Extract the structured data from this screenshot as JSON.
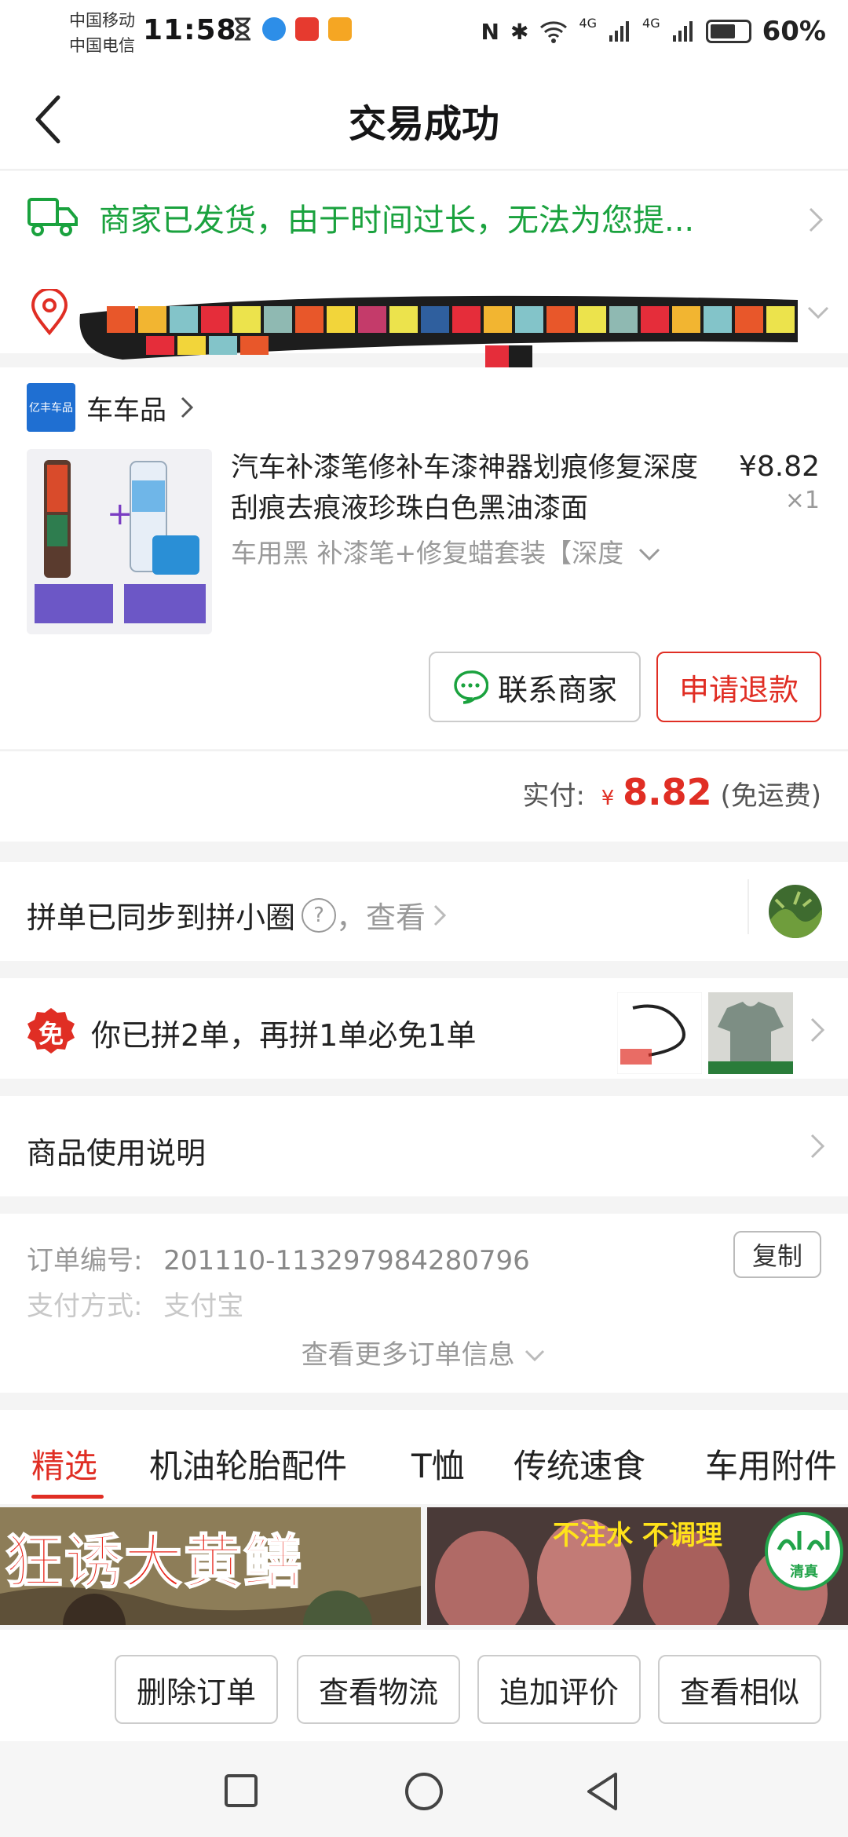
{
  "status_bar": {
    "carrier_1": "中国移动",
    "carrier_2": "中国电信",
    "time": "11:58",
    "network_1": "4G",
    "network_2": "4G",
    "battery": "60%"
  },
  "header": {
    "title": "交易成功"
  },
  "shipping": {
    "text": "商家已发货，由于时间过长，无法为您提...",
    "color": "#1aa23e"
  },
  "shop": {
    "logo_text": "亿丰车品",
    "name": "车车品"
  },
  "product": {
    "title": "汽车补漆笔修补车漆神器划痕修复深度刮痕去痕液珍珠白色黑油漆面",
    "spec": "车用黑 补漆笔+修复蜡套装【深度",
    "price": "¥8.82",
    "quantity": "×1"
  },
  "actions": {
    "contact": "联系商家",
    "refund": "申请退款"
  },
  "payment": {
    "label": "实付:",
    "currency": "¥",
    "amount": "8.82",
    "shipping_note": "(免运费)",
    "accent_color": "#e02e24"
  },
  "group_sync": {
    "text": "拼单已同步到拼小圈",
    "help": "?",
    "link": "，查看"
  },
  "free_order": {
    "badge": "免",
    "text": "你已拼2单，再拼1单必免1单"
  },
  "usage": {
    "text": "商品使用说明"
  },
  "order_info": {
    "number_label": "订单编号:",
    "number_value": "201110-113297984280796",
    "copy": "复制",
    "pay_label": "支付方式:",
    "pay_value": "支付宝",
    "more": "查看更多订单信息"
  },
  "tabs": [
    "精选",
    "机油轮胎配件",
    "T恤",
    "传统速食",
    "车用附件"
  ],
  "banners": {
    "left_text": "狂诱大黄鳝",
    "right_text": "不注水 不调理",
    "right_badge_1": "清真"
  },
  "bottom_buttons": [
    "删除订单",
    "查看物流",
    "追加评价",
    "查看相似"
  ]
}
